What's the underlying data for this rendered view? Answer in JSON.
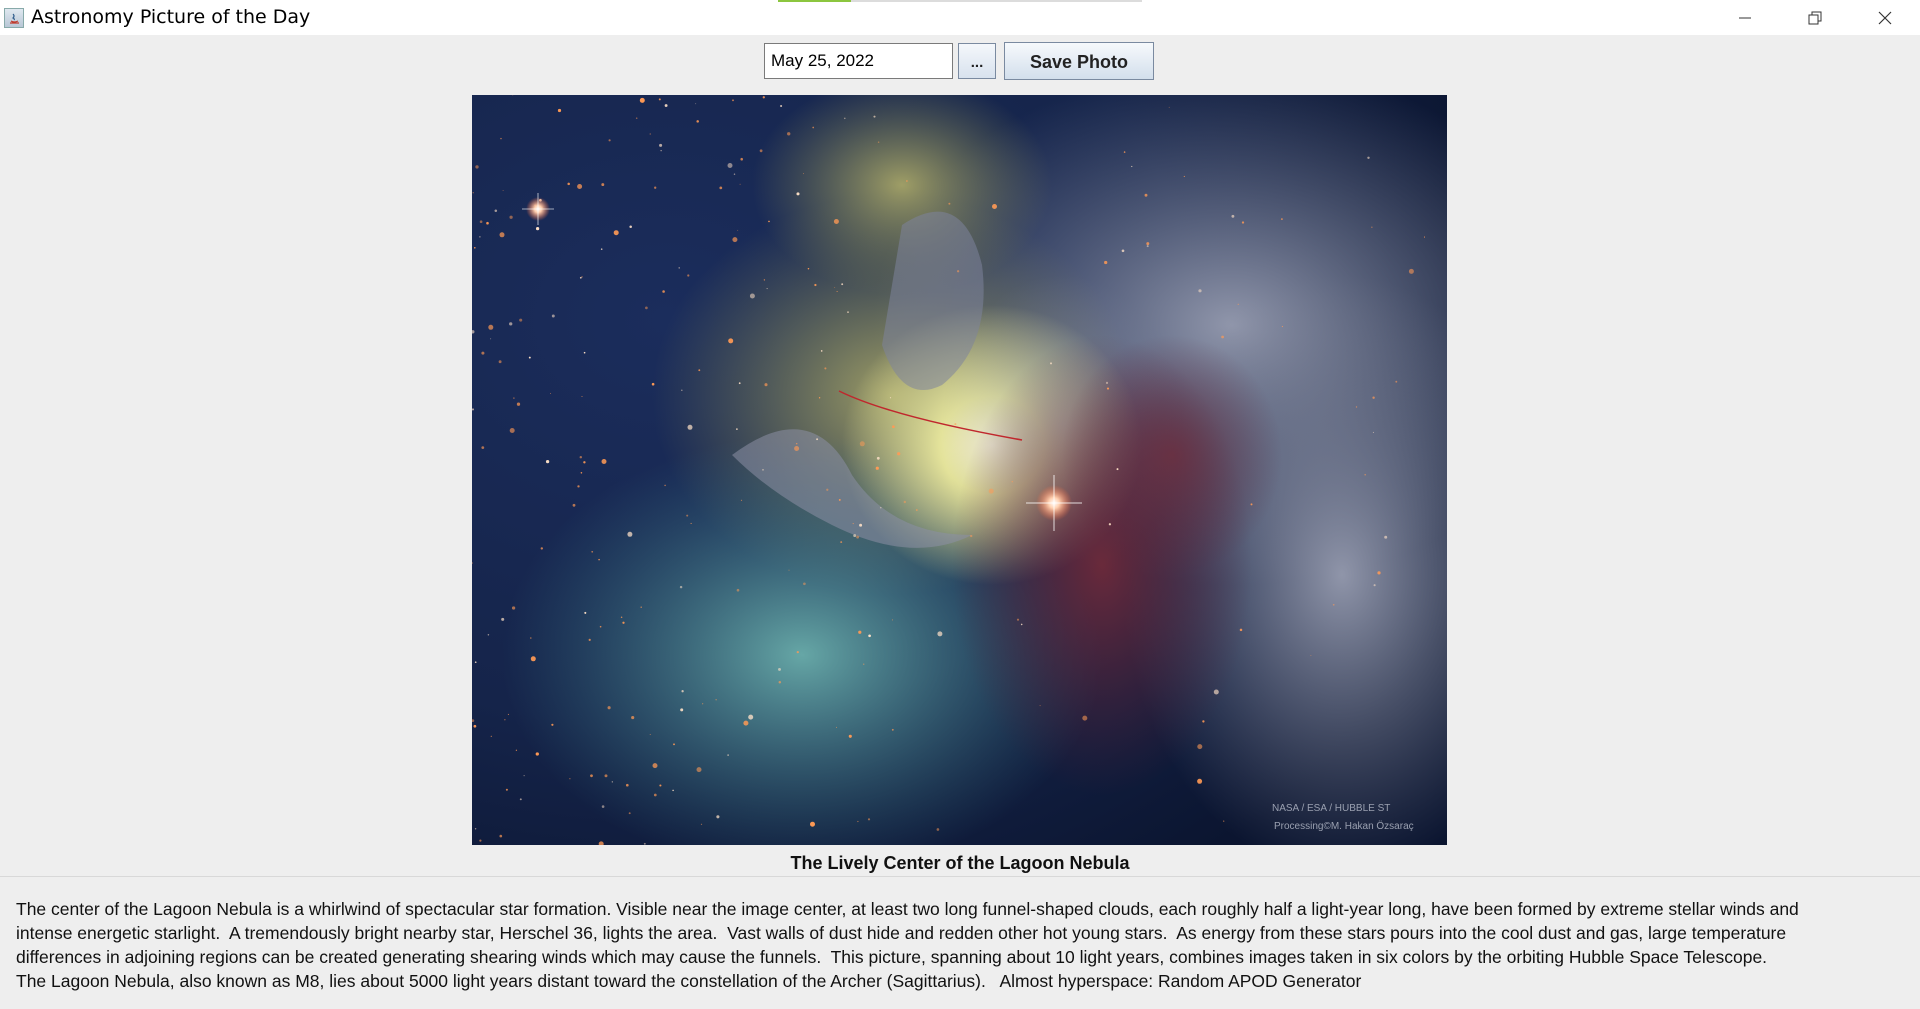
{
  "window": {
    "title": "Astronomy Picture of the Day",
    "progress_fraction": 0.2
  },
  "toolbar": {
    "date_value": "May 25, 2022",
    "picker_label": "...",
    "save_label": "Save Photo"
  },
  "photo": {
    "credit_line1": "NASA / ESA / HUBBLE ST",
    "credit_line2": "Processing©M. Hakan Özsaraç"
  },
  "caption": "The Lively Center of the Lagoon Nebula",
  "description": "The center of the Lagoon Nebula is a whirlwind of spectacular star formation. Visible near the image center, at least two long funnel-shaped clouds, each roughly half a light-year long, have been formed by extreme stellar winds and\nintense energetic starlight.  A tremendously bright nearby star, Herschel 36, lights the area.  Vast walls of dust hide and redden other hot young stars.  As energy from these stars pours into the cool dust and gas, large temperature\ndifferences in adjoining regions can be created generating shearing winds which may cause the funnels.  This picture, spanning about 10 light years, combines images taken in six colors by the orbiting Hubble Space Telescope.\nThe Lagoon Nebula, also known as M8, lies about 5000 light years distant toward the constellation of the Archer (Sagittarius).   Almost hyperspace: Random APOD Generator"
}
